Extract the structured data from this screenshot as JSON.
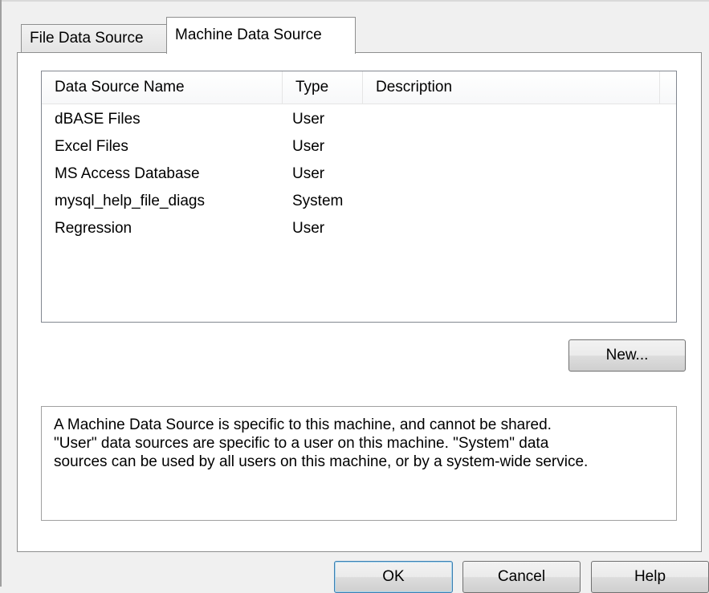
{
  "tabs": [
    {
      "label": "File Data Source",
      "active": false
    },
    {
      "label": "Machine Data Source",
      "active": true
    }
  ],
  "list": {
    "columns": [
      "Data Source Name",
      "Type",
      "Description"
    ],
    "rows": [
      {
        "name": "dBASE Files",
        "type": "User",
        "description": ""
      },
      {
        "name": "Excel Files",
        "type": "User",
        "description": ""
      },
      {
        "name": "MS Access Database",
        "type": "User",
        "description": ""
      },
      {
        "name": "mysql_help_file_diags",
        "type": "System",
        "description": ""
      },
      {
        "name": "Regression",
        "type": "User",
        "description": ""
      }
    ]
  },
  "buttons": {
    "new": "New...",
    "ok": "OK",
    "cancel": "Cancel",
    "help": "Help"
  },
  "info": {
    "lines": [
      "A Machine Data Source is specific to this machine, and cannot be shared.",
      "\"User\" data sources are specific to a user on this machine.  \"System\" data",
      "sources can be used by all users on this machine, or by a system-wide service."
    ]
  },
  "colors": {
    "background": "#f0f0f0",
    "panel": "#ffffff",
    "border": "#8e8f8f",
    "default_button_border": "#3c7fb1"
  }
}
